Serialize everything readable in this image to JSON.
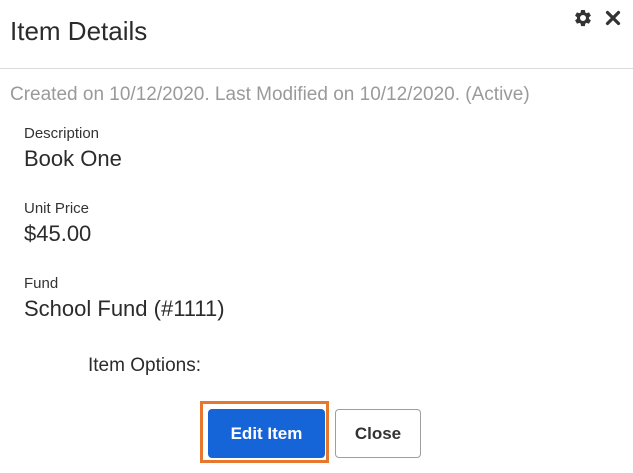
{
  "dialog": {
    "title": "Item Details",
    "meta_text": "Created on 10/12/2020. Last Modified on 10/12/2020. (Active)"
  },
  "icons": {
    "settings": "gear-icon",
    "close": "close-icon"
  },
  "fields": {
    "description": {
      "label": "Description",
      "value": "Book One"
    },
    "unit_price": {
      "label": "Unit Price",
      "value": "$45.00"
    },
    "fund": {
      "label": "Fund",
      "value": "School Fund (#1111)"
    }
  },
  "options": {
    "label": "Item Options:"
  },
  "buttons": {
    "edit_label": "Edit Item",
    "close_label": "Close"
  },
  "colors": {
    "primary": "#1565d8",
    "focus": "#e8772e",
    "muted_text": "#9a9a9a"
  }
}
